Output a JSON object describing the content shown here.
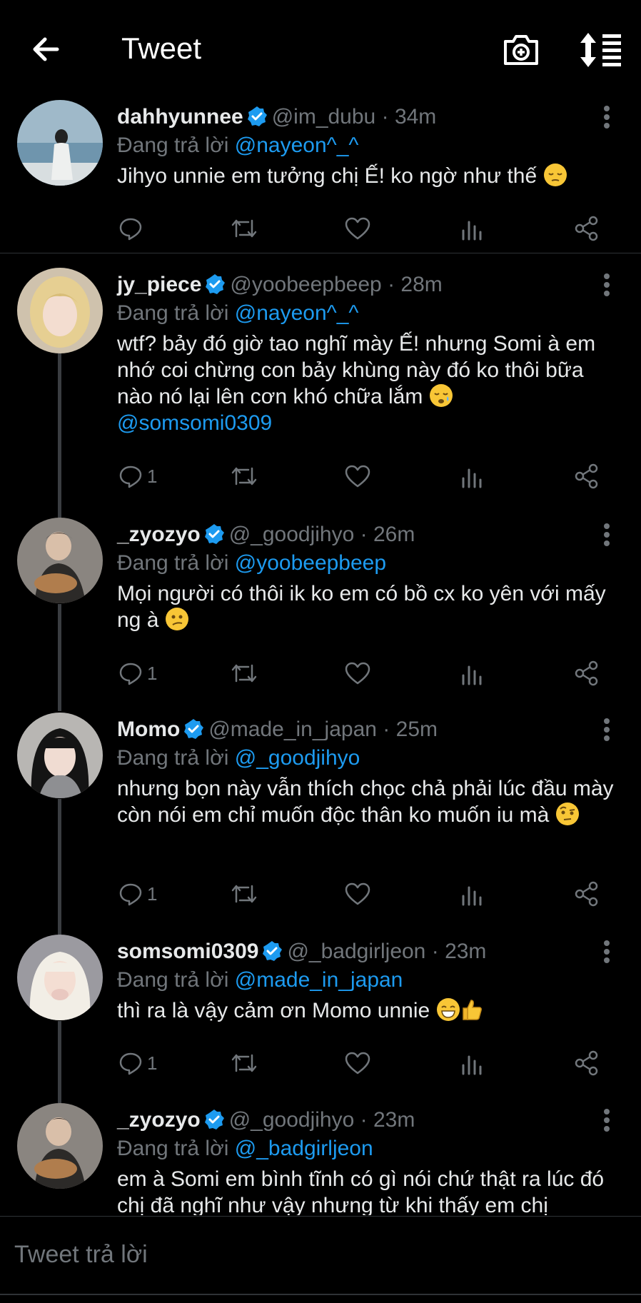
{
  "header": {
    "title": "Tweet"
  },
  "tweets": [
    {
      "name": "dahhyunnee",
      "handle": "@im_dubu",
      "time": "34m",
      "reply_prefix": "Đang trả lời",
      "reply_to": "@nayeon^_^",
      "text": "Jihyo unnie em tưởng chị Ế! ko ngờ như thế",
      "emoji": "pensive-face",
      "reply_count": ""
    },
    {
      "name": "jy_piece",
      "handle": "@yoobeepbeep",
      "time": "28m",
      "reply_prefix": "Đang trả lời",
      "reply_to": "@nayeon^_^",
      "text": "wtf? bảy đó giờ tao nghĩ mày Ế! nhưng Somi à em nhớ coi chừng con bảy khùng này đó ko thôi bữa nào nó lại lên cơn khó chữa lắm",
      "emoji": "sleepy-face",
      "mention": "@somsomi0309",
      "reply_count": "1"
    },
    {
      "name": "_zyozyo",
      "handle": "@_goodjihyo",
      "time": "26m",
      "reply_prefix": "Đang trả lời",
      "reply_to": "@yoobeepbeep",
      "text": "Mọi người có thôi ik ko em có bồ cx ko yên với mấy ng à",
      "emoji": "confused-face",
      "reply_count": "1"
    },
    {
      "name": "Momo",
      "handle": "@made_in_japan",
      "time": "25m",
      "reply_prefix": "Đang trả lời",
      "reply_to": "@_goodjihyo",
      "text": "nhưng bọn này vẫn thích chọc chả phải lúc đầu mày còn nói em chỉ muốn độc thân ko muốn iu mà",
      "emoji": "face-raised-eyebrow",
      "reply_count": "1"
    },
    {
      "name": "somsomi0309",
      "handle": "@_badgirljeon",
      "time": "23m",
      "reply_prefix": "Đang trả lời",
      "reply_to": "@made_in_japan",
      "text": "thì ra là vậy cảm ơn Momo unnie",
      "emoji": "grinning-face thumbs-up",
      "reply_count": "1"
    },
    {
      "name": "_zyozyo",
      "handle": "@_goodjihyo",
      "time": "23m",
      "reply_prefix": "Đang trả lời",
      "reply_to": "@_badgirljeon",
      "text": "em à Somi em bình tĩnh có gì nói chứ thật ra lúc đó chị đã nghĩ như vậy nhưng từ khi thấy em chị",
      "reply_count": ""
    }
  ],
  "separator": "·",
  "composer": {
    "placeholder": "Tweet trả lời"
  },
  "colors": {
    "background": "#000000",
    "accent": "#1d9bf0",
    "muted": "#71767b",
    "text": "#e7e9ea"
  },
  "icons": [
    "back-arrow-icon",
    "camera-plus-icon",
    "sort-icon",
    "verified-badge-icon",
    "more-icon",
    "reply-icon",
    "retweet-icon",
    "like-icon",
    "stats-icon",
    "share-icon"
  ]
}
